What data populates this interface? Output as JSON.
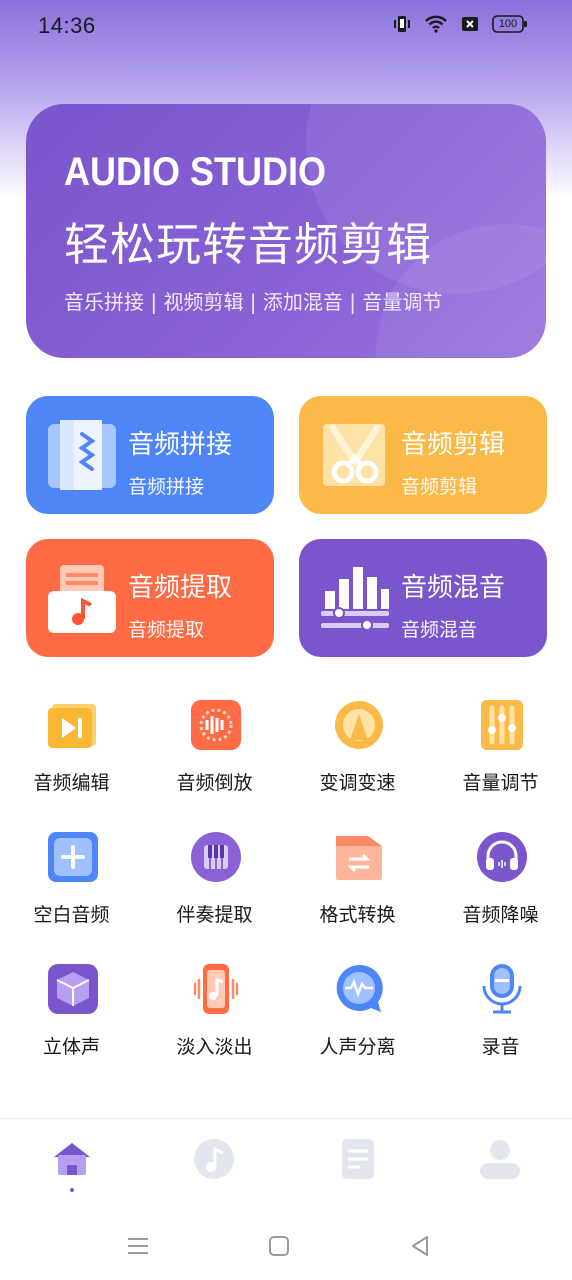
{
  "status_bar": {
    "time": "14:36",
    "battery": "100"
  },
  "banner": {
    "title": "AUDIO STUDIO",
    "subtitle": "轻松玩转音频剪辑",
    "tags": "音乐拼接 | 视频剪辑 | 添加混音 | 音量调节"
  },
  "cards": [
    {
      "title": "音频拼接",
      "subtitle": "音频拼接",
      "color": "#4f86f7",
      "icon": "audio-splice-icon"
    },
    {
      "title": "音频剪辑",
      "subtitle": "音频剪辑",
      "color": "#fbb948",
      "icon": "scissors-icon"
    },
    {
      "title": "音频提取",
      "subtitle": "音频提取",
      "color": "#ff6b45",
      "icon": "music-folder-icon"
    },
    {
      "title": "音频混音",
      "subtitle": "音频混音",
      "color": "#7b55cc",
      "icon": "mixer-icon"
    }
  ],
  "tools": [
    {
      "label": "音频编辑",
      "icon": "audio-edit-icon"
    },
    {
      "label": "音频倒放",
      "icon": "reverse-play-icon"
    },
    {
      "label": "变调变速",
      "icon": "pitch-speed-icon"
    },
    {
      "label": "音量调节",
      "icon": "volume-slider-icon"
    },
    {
      "label": "空白音频",
      "icon": "blank-audio-icon"
    },
    {
      "label": "伴奏提取",
      "icon": "piano-icon"
    },
    {
      "label": "格式转换",
      "icon": "format-convert-icon"
    },
    {
      "label": "音频降噪",
      "icon": "headphones-icon"
    },
    {
      "label": "立体声",
      "icon": "cube-icon"
    },
    {
      "label": "淡入淡出",
      "icon": "fade-icon"
    },
    {
      "label": "人声分离",
      "icon": "voice-wave-icon"
    },
    {
      "label": "录音",
      "icon": "microphone-icon"
    }
  ],
  "bottom_nav": [
    {
      "name": "home",
      "icon": "home-icon",
      "active": true
    },
    {
      "name": "music",
      "icon": "music-note-icon",
      "active": false
    },
    {
      "name": "files",
      "icon": "document-icon",
      "active": false
    },
    {
      "name": "profile",
      "icon": "user-icon",
      "active": false
    }
  ],
  "colors": {
    "accent": "#7b55cc",
    "inactive_nav": "#e3e6ee"
  }
}
